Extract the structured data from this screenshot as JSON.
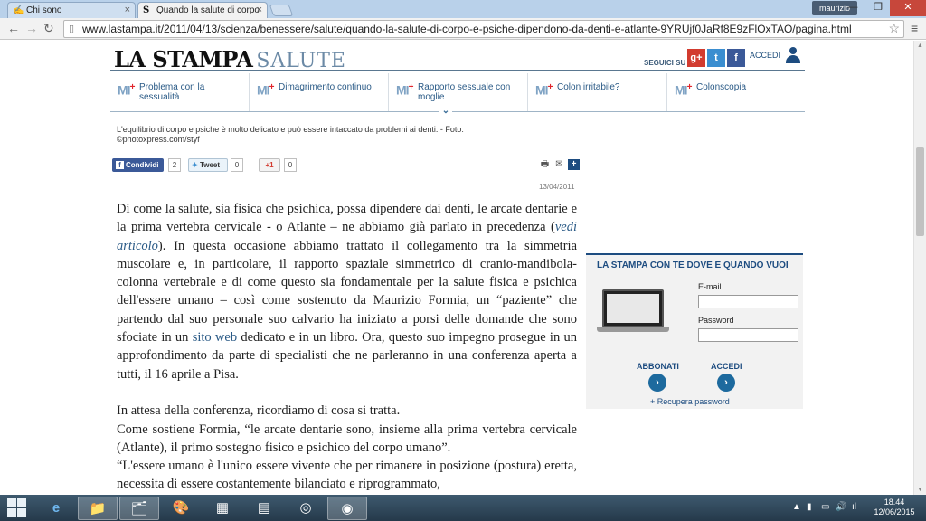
{
  "browser": {
    "tabs": [
      {
        "label": "Chi sono",
        "active": false,
        "favicon": "pen-logo-icon"
      },
      {
        "label": "Quando la salute di corpo",
        "active": true,
        "favicon": "lastampa-s-icon"
      }
    ],
    "user": "maurizio",
    "url": "www.lastampa.it/2011/04/13/scienza/benessere/salute/quando-la-salute-di-corpo-e-psiche-dipendono-da-denti-e-atlante-9YRUjf0JaRf8E9zFlOxTAO/pagina.html"
  },
  "site": {
    "logo_main": "LA STAMPA",
    "logo_section": "SALUTE",
    "follow_label": "SEGUICI SU",
    "social": {
      "gplus": "g+",
      "twitter": "t",
      "facebook": "f"
    },
    "login_label": "ACCEDI"
  },
  "topics": [
    {
      "badge": "MI",
      "label": "Problema con la sessualità"
    },
    {
      "badge": "MI",
      "label": "Dimagrimento continuo"
    },
    {
      "badge": "MI",
      "label": "Rapporto sessuale con moglie"
    },
    {
      "badge": "MI",
      "label": "Colon irritabile?"
    },
    {
      "badge": "MI",
      "label": "Colonscopia"
    }
  ],
  "caption": "L'equilibrio di corpo e psiche è molto delicato e può essere intaccato da problemi ai denti. - Foto: ©photoxpress.com/styf",
  "share": {
    "facebook_label": "Condividi",
    "facebook_count": "2",
    "tweet_label": "Tweet",
    "tweet_count": "0",
    "gplus_label": "+1",
    "gplus_count": "0"
  },
  "date": "13/04/2011",
  "article": {
    "p1_a": "Di come la salute, sia fisica che psichica, possa dipendere dai denti, le arcate dentarie e la prima vertebra cervicale - o Atlante – ne abbiamo già parlato in precedenza (",
    "p1_link1": "vedi articolo",
    "p1_b": "). In questa occasione abbiamo trattato il collegamento tra la simmetria muscolare e, in particolare, il rapporto spaziale simmetrico di cranio-mandibola-colonna vertebrale e di come questo sia fondamentale per la salute fisica e psichica dell'essere umano – così come sostenuto da Maurizio Formia, un “paziente” che partendo dal suo personale suo calvario ha iniziato a porsi delle domande che sono sfociate in un ",
    "p1_link2": "sito web",
    "p1_c": " dedicato e in un libro. Ora, questo suo impegno prosegue in un approfondimento da parte di specialisti che ne parleranno in una conferenza aperta a tutti, il 16 aprile a Pisa.",
    "p2": "In attesa della conferenza, ricordiamo di cosa si tratta.",
    "p3": "Come sostiene Formia, “le arcate dentarie sono, insieme alla prima vertebra cervicale (Atlante), il primo sostegno fisico e psichico del corpo umano”.",
    "p4": "“L'essere umano è l'unico essere vivente che per rimanere in posizione (postura) eretta, necessita di essere costantemente bilanciato e riprogrammato,"
  },
  "sidebar": {
    "title": "LA STAMPA CON TE DOVE E QUANDO VUOI",
    "email_label": "E-mail",
    "password_label": "Password",
    "subscribe_label": "ABBONATI",
    "login_label": "ACCEDI",
    "recover_label": "+ Recupera password"
  },
  "taskbar": {
    "time": "18.44",
    "date": "12/06/2015"
  }
}
